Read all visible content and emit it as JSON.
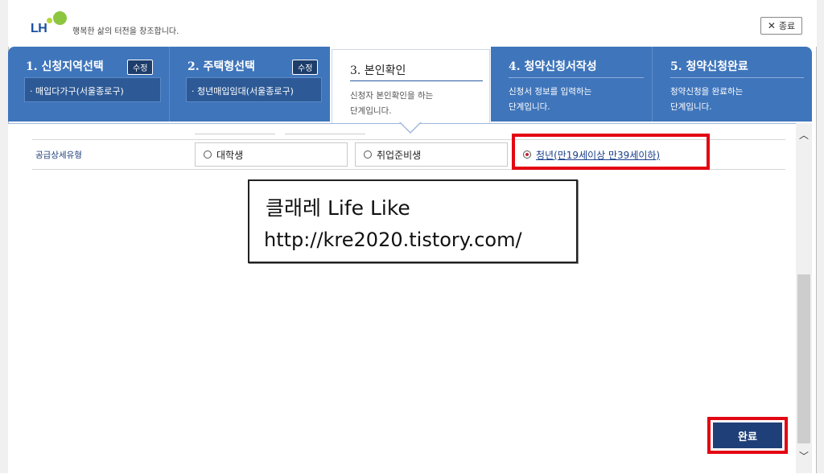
{
  "header": {
    "logo_text": "LH",
    "slogan": "행복한 삶의 터전을 창조합니다.",
    "close_label": "종료"
  },
  "steps": [
    {
      "title": "1. 신청지역선택",
      "edit": "수정",
      "chip": "· 매입다가구(서울종로구)"
    },
    {
      "title": "2. 주택형선택",
      "edit": "수정",
      "chip": "· 청년매입임대(서울종로구)"
    },
    {
      "title": "3. 본인확인",
      "desc1": "신청자 본인확인을 하는",
      "desc2": "단계입니다."
    },
    {
      "title": "4. 청약신청서작성",
      "desc1": "신청서 정보를 입력하는",
      "desc2": "단계입니다."
    },
    {
      "title": "5. 청약신청완료",
      "desc1": "청약신청을 완료하는",
      "desc2": "단계입니다."
    }
  ],
  "form": {
    "row_label": "공급상세유형",
    "options": [
      {
        "label": "대학생",
        "selected": false
      },
      {
        "label": "취업준비생",
        "selected": false
      },
      {
        "label": "청년(만19세이상 만39세이하)",
        "selected": true
      }
    ]
  },
  "watermark": {
    "line1": "클래레 Life Like",
    "line2": "http://kre2020.tistory.com/"
  },
  "actions": {
    "done_label": "완료"
  },
  "colors": {
    "step_bar": "#3f75bb",
    "highlight": "#e30613",
    "button": "#1f3f78"
  }
}
